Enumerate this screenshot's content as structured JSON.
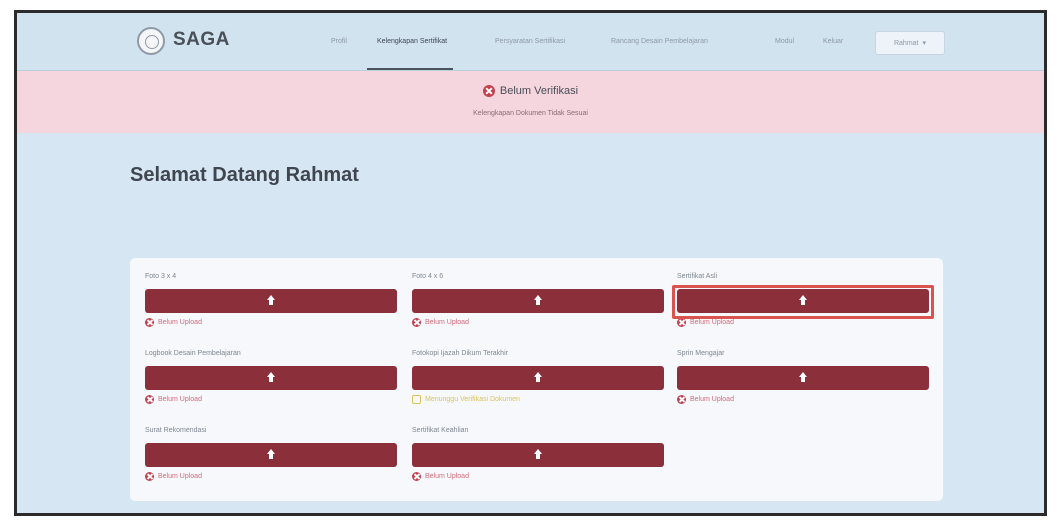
{
  "navbar": {
    "brand": "SAGA",
    "items": [
      {
        "label": "Profil"
      },
      {
        "label": "Kelengkapan Sertifikat"
      },
      {
        "label": "Persyaratan Sertifikasi"
      },
      {
        "label": "Rancang Desain Pembelajaran"
      },
      {
        "label": "Modul"
      },
      {
        "label": "Keluar"
      }
    ],
    "user_button": "Rahmat",
    "user_caret": "▾"
  },
  "alert": {
    "title": "Belum Verifikasi",
    "subtitle": "Kelengkapan Dokumen Tidak Sesuai"
  },
  "welcome": "Selamat Datang Rahmat",
  "documents": [
    {
      "label": "Foto 3 x 4",
      "status": "Belum Upload"
    },
    {
      "label": "Foto 4 x 6",
      "status": "Belum Upload"
    },
    {
      "label": "Sertifikat Asli",
      "status": "Belum Upload"
    },
    {
      "label": "Logbook Desain Pembelajaran",
      "status": "Belum Upload"
    },
    {
      "label": "Fotokopi Ijazah Dikum Terakhir",
      "status": "Menunggu Verifikasi Dokumen"
    },
    {
      "label": "Sprin Mengajar",
      "status": "Belum Upload"
    },
    {
      "label": "Surat Rekomendasi",
      "status": "Belum Upload"
    },
    {
      "label": "Sertifikat Keahlian",
      "status": "Belum Upload"
    }
  ],
  "colors": {
    "upload_button": "#8b2f3a",
    "alert_bg": "#f5d5de",
    "status_error": "#d36b7a",
    "status_pending": "#d8c45a",
    "highlight": "#d9534f"
  },
  "icons": {
    "logo": "saga-logo-icon",
    "upload": "upload-icon",
    "error": "x-circle-icon",
    "pending": "clock-icon"
  }
}
